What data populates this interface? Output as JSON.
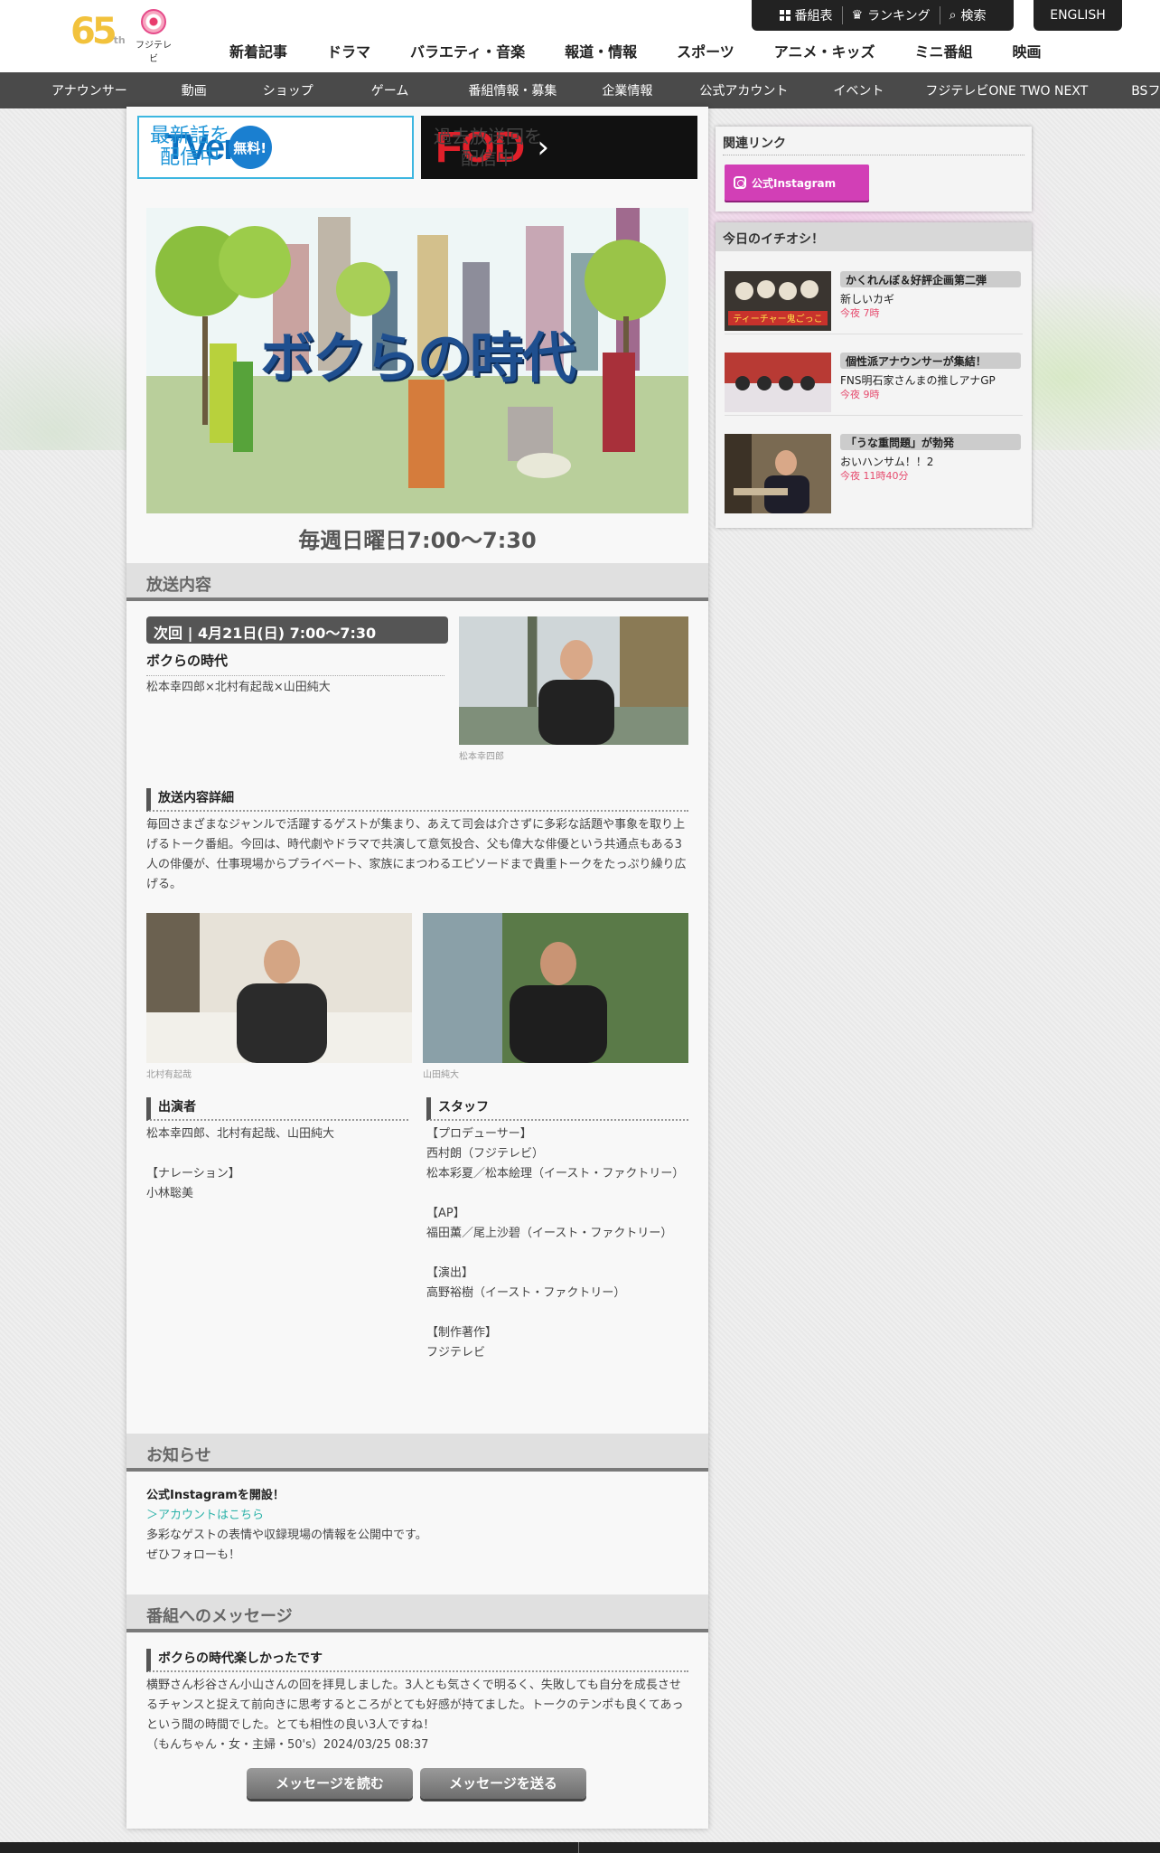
{
  "header": {
    "logo_65": "65",
    "logo_th": "th",
    "logo_fuji": "フジテレビ",
    "topbar": [
      {
        "label": "番組表",
        "icon": "grid-icon"
      },
      {
        "label": "ランキング",
        "icon": "crown-icon"
      },
      {
        "label": "検索",
        "icon": "search-icon"
      }
    ],
    "english": "ENGLISH",
    "nav": [
      "新着記事",
      "ドラマ",
      "バラエティ・音楽",
      "報道・情報",
      "スポーツ",
      "アニメ・キッズ",
      "ミニ番組",
      "映画"
    ],
    "subnav": [
      "アナウンサー",
      "動画",
      "ショップ",
      "ゲーム",
      "番組情報・募集",
      "企業情報",
      "公式アカウント",
      "イベント",
      "フジテレビONE TWO NEXT",
      "BSフジ"
    ]
  },
  "banners": {
    "tver_logo": "TVer",
    "tver_free": "無料!",
    "tver_text": [
      "最新話を",
      "配信中"
    ],
    "fod_logo": "FOD",
    "fod_text": [
      "過去放送回を",
      "配信中"
    ]
  },
  "show": {
    "title": "ボクらの時代",
    "timeslot": "毎週日曜日7:00〜7:30"
  },
  "broadcast": {
    "section_title": "放送内容",
    "next_label": "次回 | 4月21日(日) 7:00〜7:30",
    "episode_title": "ボクらの時代",
    "guests": "松本幸四郎×北村有起哉×山田純大",
    "photo_caption_1": "松本幸四郎",
    "detail_heading": "放送内容詳細",
    "detail_text": "毎回さまざまなジャンルで活躍するゲストが集まり、あえて司会は介さずに多彩な話題や事象を取り上げるトーク番組。今回は、時代劇やドラマで共演して意気投合、父も偉大な俳優という共通点もある3人の俳優が、仕事現場からプライベート、家族にまつわるエピソードまで貴重トークをたっぷり繰り広げる。",
    "photo_caption_2": "北村有起哉",
    "photo_caption_3": "山田純大",
    "cast_heading": "出演者",
    "cast_lines": [
      "松本幸四郎、北村有起哉、山田純大",
      "",
      "【ナレーション】",
      "小林聡美"
    ],
    "staff_heading": "スタッフ",
    "staff_lines": [
      "【プロデューサー】",
      "西村朗（フジテレビ）",
      "松本彩夏／松本絵理（イースト・ファクトリー）",
      "",
      "【AP】",
      "福田薫／尾上沙碧（イースト・ファクトリー）",
      "",
      "【演出】",
      "高野裕樹（イースト・ファクトリー）",
      "",
      "【制作著作】",
      "フジテレビ"
    ]
  },
  "notice": {
    "section_title": "お知らせ",
    "title": "公式Instagramを開設！",
    "link": "＞アカウントはこちら",
    "lines": [
      "多彩なゲストの表情や収録現場の情報を公開中です。",
      "ぜひフォローも！"
    ]
  },
  "message": {
    "section_title": "番組へのメッセージ",
    "heading": "ボクらの時代楽しかったです",
    "body": "横野さん杉谷さん小山さんの回を拝見しました。3人とも気さくで明るく、失敗しても自分を成長させるチャンスと捉えて前向きに思考するところがとても好感が持てました。トークのテンポも良くてあっという間の時間でした。とても相性の良い3人ですね！",
    "signature": "（もんちゃん・女・主婦・50's）2024/03/25 08:37",
    "read_button": "メッセージを読む",
    "send_button": "メッセージを送る"
  },
  "sidebar": {
    "related_title": "関連リンク",
    "instagram_label": "公式Instagram",
    "pick_title": "今日のイチオシ！",
    "picks": [
      {
        "tag": "かくれんぼ＆好評企画第二弾",
        "title": "新しいカギ",
        "time": "今夜 7時",
        "thumb_text": "ティーチャー鬼ごっこ"
      },
      {
        "tag": "個性派アナウンサーが集結！",
        "title": "FNS明石家さんまの推しアナGP",
        "time": "今夜 9時",
        "thumb_text": ""
      },
      {
        "tag": "「うな重問題」が勃発",
        "title": "おいハンサム！！2",
        "time": "今夜 11時40分",
        "thumb_text": ""
      }
    ]
  }
}
